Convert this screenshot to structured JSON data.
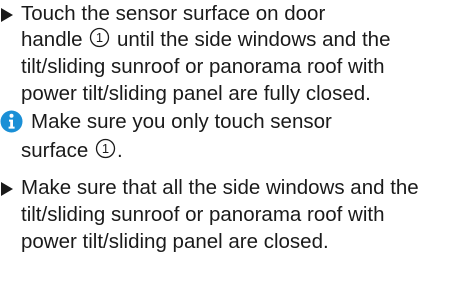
{
  "instructions": [
    {
      "marker": "arrow-bullet",
      "lines": [
        {
          "before": "Touch the sensor surface on door"
        },
        {
          "before": "handle",
          "ref": "1",
          "after": "until the side windows and the"
        },
        {
          "before": "tilt/sliding sunroof or panorama roof with"
        },
        {
          "before": "power tilt/sliding panel are fully closed."
        }
      ]
    },
    {
      "marker": "info-icon",
      "lines": [
        {
          "before": "Make sure you only touch sensor"
        },
        {
          "before": "surface",
          "ref": "1",
          "after": "."
        }
      ]
    },
    {
      "marker": "arrow-bullet",
      "lines": [
        {
          "before": "Make sure that all the side windows and the"
        },
        {
          "before": "tilt/sliding sunroof or panorama roof with"
        },
        {
          "before": "power tilt/sliding panel are closed."
        }
      ]
    }
  ],
  "colors": {
    "text": "#1a1a1a",
    "info_icon": "#1a8fd6",
    "background": "#ffffff"
  }
}
